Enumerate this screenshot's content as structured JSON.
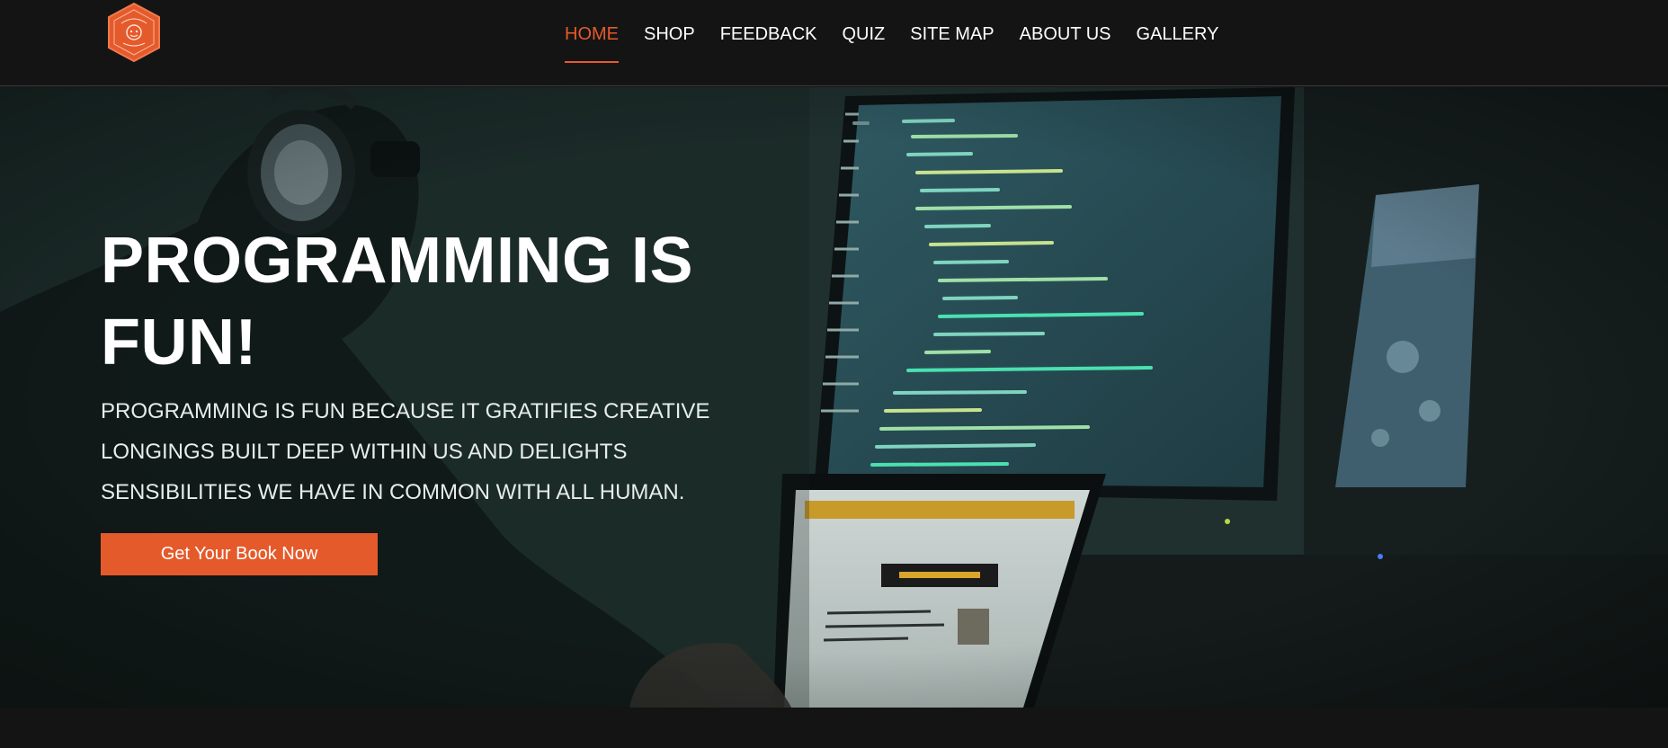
{
  "header": {
    "logo_icon": "hexagon-badge-logo",
    "brand_color": "#e55a2b",
    "nav": [
      {
        "label": "HOME",
        "active": true
      },
      {
        "label": "SHOP",
        "active": false
      },
      {
        "label": "FEEDBACK",
        "active": false
      },
      {
        "label": "QUIZ",
        "active": false
      },
      {
        "label": "SITE MAP",
        "active": false
      },
      {
        "label": "ABOUT US",
        "active": false
      },
      {
        "label": "GALLERY",
        "active": false
      }
    ]
  },
  "hero": {
    "title": "PROGRAMMING IS FUN!",
    "description": "PROGRAMMING IS FUN BECAUSE IT GRATIFIES CREATIVE LONGINGS BUILT DEEP WITHIN US AND DELIGHTS SENSIBILITIES WE HAVE IN COMMON WITH ALL HUMAN.",
    "cta_label": "Get Your Book Now",
    "background_image": "person-with-headphones-coding-at-monitors"
  }
}
